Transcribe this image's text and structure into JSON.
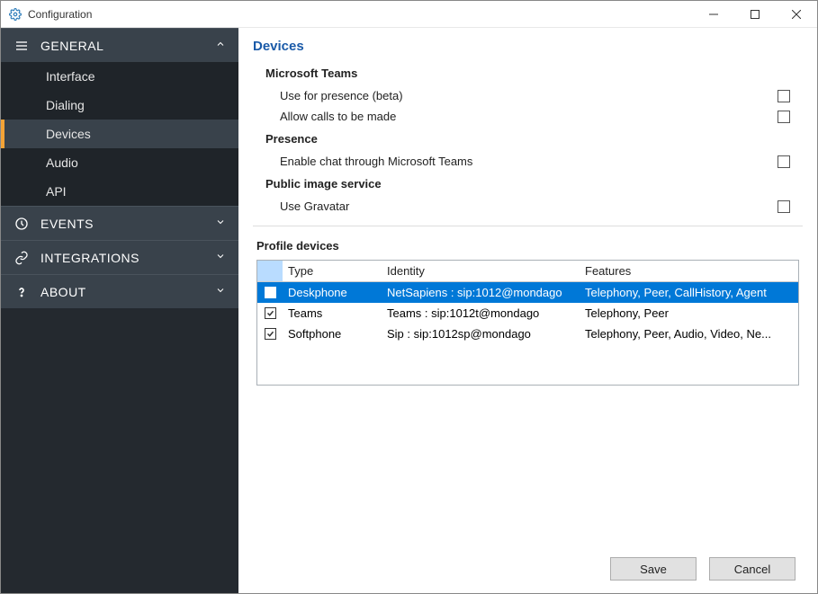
{
  "window": {
    "title": "Configuration"
  },
  "sidebar": {
    "sections": [
      {
        "label": "GENERAL",
        "expanded": true,
        "items": [
          {
            "label": "Interface"
          },
          {
            "label": "Dialing"
          },
          {
            "label": "Devices",
            "active": true
          },
          {
            "label": "Audio"
          },
          {
            "label": "API"
          }
        ]
      },
      {
        "label": "EVENTS",
        "expanded": false
      },
      {
        "label": "INTEGRATIONS",
        "expanded": false
      },
      {
        "label": "ABOUT",
        "expanded": false
      }
    ]
  },
  "page": {
    "title": "Devices",
    "groups": [
      {
        "title": "Microsoft Teams",
        "options": [
          {
            "label": "Use for presence (beta)",
            "checked": false
          },
          {
            "label": "Allow calls to be made",
            "checked": false
          }
        ]
      },
      {
        "title": "Presence",
        "options": [
          {
            "label": "Enable chat through Microsoft Teams",
            "checked": false
          }
        ]
      },
      {
        "title": "Public image service",
        "options": [
          {
            "label": "Use Gravatar",
            "checked": false
          }
        ]
      }
    ],
    "profile_devices": {
      "title": "Profile devices",
      "columns": [
        "Type",
        "Identity",
        "Features"
      ],
      "rows": [
        {
          "checked": true,
          "selected": true,
          "type": "Deskphone",
          "identity": "NetSapiens : sip:1012@mondago",
          "features": "Telephony, Peer, CallHistory, Agent"
        },
        {
          "checked": true,
          "selected": false,
          "type": "Teams",
          "identity": "Teams : sip:1012t@mondago",
          "features": "Telephony, Peer"
        },
        {
          "checked": true,
          "selected": false,
          "type": "Softphone",
          "identity": "Sip : sip:1012sp@mondago",
          "features": "Telephony, Peer, Audio, Video, Ne..."
        }
      ]
    }
  },
  "footer": {
    "save": "Save",
    "cancel": "Cancel"
  }
}
